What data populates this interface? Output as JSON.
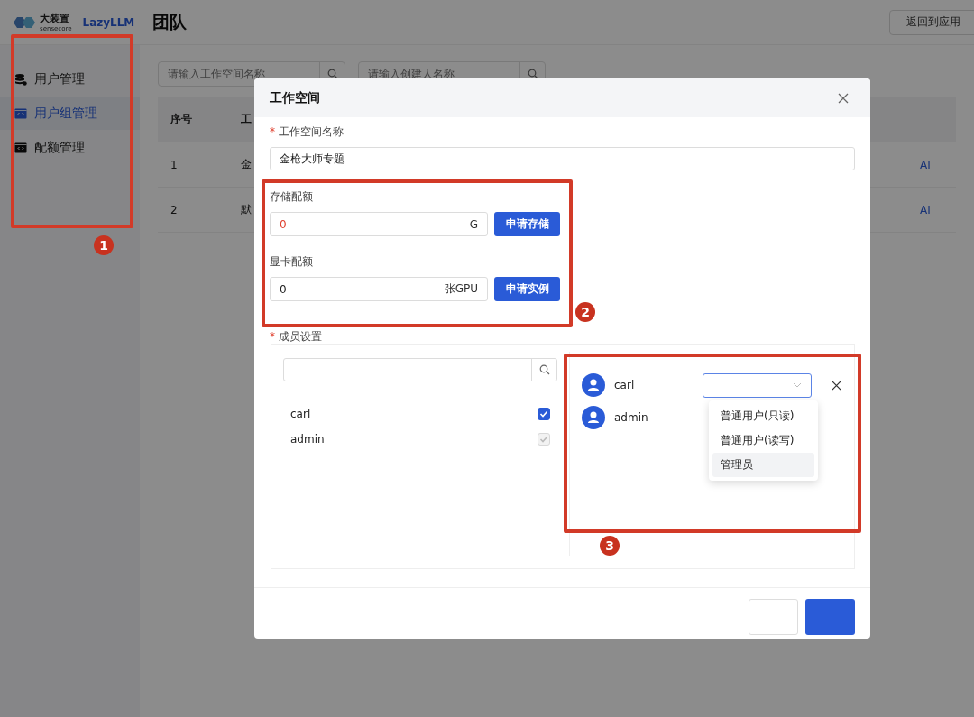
{
  "header": {
    "logo_text": "大装置",
    "logo_sub": "sensecore",
    "product": "LazyLLM",
    "title": "团队",
    "back_button": "返回到应用"
  },
  "sidebar": {
    "items": [
      {
        "label": "用户管理",
        "selected": false
      },
      {
        "label": "用户组管理",
        "selected": true
      },
      {
        "label": "配额管理",
        "selected": false
      }
    ]
  },
  "filters": [
    {
      "placeholder": "请输入工作空间名称"
    },
    {
      "placeholder": "请输入创建人名称"
    }
  ],
  "table": {
    "columns": [
      "序号",
      "工"
    ],
    "rows": [
      {
        "index": "1",
        "name": "金",
        "action": "AI"
      },
      {
        "index": "2",
        "name": "默",
        "action": "AI"
      }
    ]
  },
  "dialog": {
    "title": "工作空间",
    "name_label": "工作空间名称",
    "name_required_mark": "*",
    "name_value": "金枪大师专题",
    "storage": {
      "label": "存储配额",
      "value": "0",
      "unit": "G",
      "error": true,
      "button": "申请存储"
    },
    "gpu": {
      "label": "显卡配额",
      "value": "0",
      "unit": "张GPU",
      "error": false,
      "button": "申请实例"
    },
    "members_required_mark": "*",
    "members_label": "成员设置",
    "candidates": [
      {
        "name": "carl",
        "checked": true,
        "disabled": false
      },
      {
        "name": "admin",
        "checked": true,
        "disabled": true
      }
    ],
    "members": [
      {
        "name": "carl",
        "has_select": true
      },
      {
        "name": "admin",
        "has_select": false
      }
    ],
    "role_options": [
      {
        "label": "普通用户(只读)",
        "highlighted": false
      },
      {
        "label": "普通用户(读写)",
        "highlighted": false
      },
      {
        "label": "管理员",
        "highlighted": true
      }
    ]
  },
  "annotations": [
    {
      "number": "1"
    },
    {
      "number": "2"
    },
    {
      "number": "3"
    }
  ]
}
